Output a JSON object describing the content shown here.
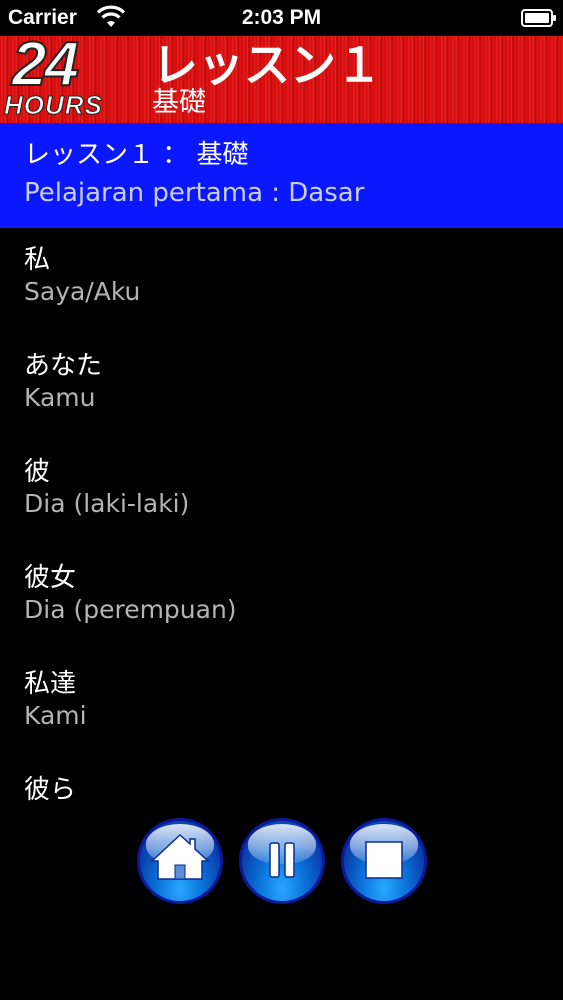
{
  "status_bar": {
    "carrier": "Carrier",
    "time": "2:03 PM",
    "wifi_icon": "wifi-icon",
    "battery_icon": "battery-icon"
  },
  "header": {
    "logo_number": "24",
    "logo_word": "HOURS",
    "title": "レッスン１",
    "subtitle": "基礎",
    "background_color": "#e01010"
  },
  "lesson": {
    "title": "レッスン１ ： 基礎",
    "subtitle": "Pelajaran pertama : Dasar",
    "background_color": "#0a17ff"
  },
  "vocab": [
    {
      "jp": "私",
      "id": "Saya/Aku"
    },
    {
      "jp": "あなた",
      "id": "Kamu"
    },
    {
      "jp": "彼",
      "id": "Dia (laki-laki)"
    },
    {
      "jp": "彼女",
      "id": "Dia (perempuan)"
    },
    {
      "jp": "私達",
      "id": "Kami"
    },
    {
      "jp": "彼ら",
      "id": ""
    }
  ],
  "controls": {
    "home_icon": "home-icon",
    "pause_icon": "pause-icon",
    "stop_icon": "stop-icon"
  }
}
